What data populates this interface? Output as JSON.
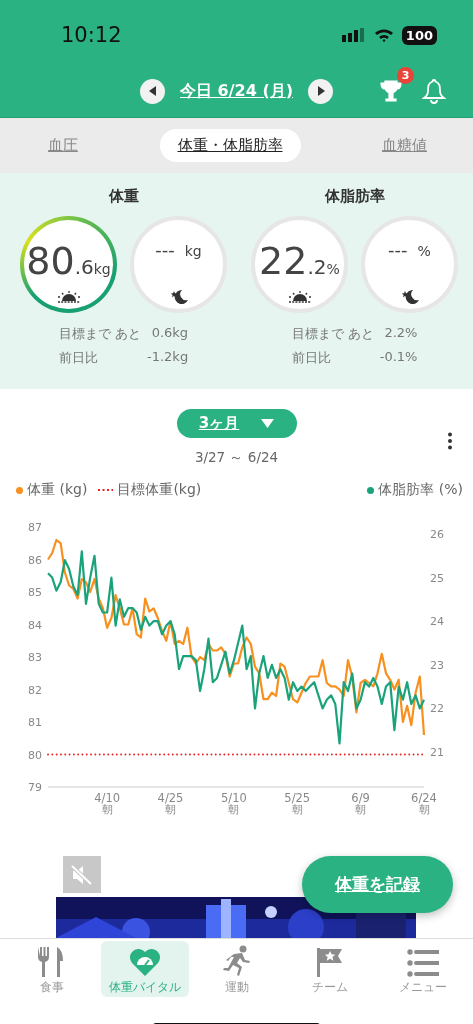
{
  "status_bar": {
    "time": "10:12",
    "battery": "100"
  },
  "header": {
    "date": "今日 6/24 (月)",
    "trophy_badge": "3"
  },
  "tabs": [
    {
      "label": "血圧",
      "selected": false
    },
    {
      "label": "体重・体脂肪率",
      "selected": true
    },
    {
      "label": "血糖値",
      "selected": false
    }
  ],
  "summary": [
    {
      "title": "体重",
      "circles": [
        {
          "kind": "morning",
          "value": "80",
          "decimal": ".6",
          "unit": "kg",
          "highlighted": true
        },
        {
          "kind": "evening",
          "value": "---",
          "unit": "kg",
          "highlighted": false
        }
      ],
      "stats": [
        {
          "label": "目標まで あと",
          "value": "0.6kg"
        },
        {
          "label": "前日比",
          "value": "-1.2kg"
        }
      ]
    },
    {
      "title": "体脂肪率",
      "circles": [
        {
          "kind": "morning",
          "value": "22",
          "decimal": ".2",
          "unit": "%",
          "highlighted": false
        },
        {
          "kind": "evening",
          "value": "---",
          "unit": "%",
          "highlighted": false
        }
      ],
      "stats": [
        {
          "label": "目標まで あと",
          "value": "2.2%"
        },
        {
          "label": "前日比",
          "value": "-0.1%"
        }
      ]
    }
  ],
  "period": {
    "label": "3ヶ月",
    "range": "3/27 ～ 6/24"
  },
  "chart": {
    "chart_data": {
      "type": "line",
      "categories": [
        null,
        null,
        null,
        null,
        null,
        null,
        null,
        null,
        null,
        null,
        null,
        null,
        null,
        null,
        "4/10$_{朝}$",
        null,
        null,
        null,
        null,
        null,
        null,
        null,
        null,
        null,
        null,
        null,
        null,
        null,
        null,
        "4/25$_{朝}$",
        null,
        null,
        null,
        null,
        null,
        null,
        null,
        null,
        null,
        null,
        null,
        null,
        null,
        null,
        "5/10$_{朝}$",
        null,
        null,
        null,
        null,
        null,
        null,
        null,
        null,
        null,
        null,
        null,
        null,
        null,
        null,
        "5/25$_{朝}$",
        null,
        null,
        null,
        null,
        null,
        null,
        null,
        null,
        null,
        null,
        null,
        null,
        null,
        null,
        "6/9$_{朝}$",
        null,
        null,
        null,
        null,
        null,
        null,
        null,
        null,
        null,
        null,
        null,
        null,
        null,
        null,
        "6/24$_{朝}$"
      ],
      "series": [
        {
          "name": "体重 (kg)",
          "color": "#f7901e",
          "values": [
            86.0,
            86.2,
            86.6,
            86.5,
            85.6,
            85.2,
            85.1,
            84.8,
            85.4,
            85.3,
            85.0,
            85.4,
            84.8,
            84.5,
            83.9,
            84.2,
            84.9,
            84.5,
            84.0,
            84.0,
            84.5,
            83.7,
            83.6,
            84.8,
            84.4,
            84.5,
            84.2,
            83.8,
            83.5,
            84.1,
            83.4,
            83.5,
            83.4,
            83.9,
            83.0,
            82.8,
            83.0,
            82.9,
            83.4,
            83.2,
            83.2,
            83.3,
            83.1,
            82.4,
            82.8,
            82.8,
            83.3,
            83.6,
            83.4,
            82.7,
            82.5,
            81.7,
            81.7,
            81.9,
            81.8,
            82.8,
            82.7,
            82.2,
            81.7,
            81.6,
            81.9,
            82.2,
            82.4,
            82.4,
            82.4,
            82.9,
            82.2,
            82.1,
            82.1,
            82.0,
            81.8,
            82.9,
            82.4,
            81.3,
            82.2,
            82.3,
            82.2,
            82.1,
            82.5,
            83.1,
            82.5,
            82.3,
            82.0,
            82.3,
            81.0,
            81.5,
            80.9,
            81.9,
            82.4,
            80.6
          ]
        },
        {
          "name": "目標体重(kg)",
          "color": "#e52421",
          "line_style": "dotted",
          "values": [
            80,
            80,
            80,
            80,
            80,
            80,
            80,
            80,
            80,
            80,
            80,
            80,
            80,
            80,
            80,
            80,
            80,
            80,
            80,
            80,
            80,
            80,
            80,
            80,
            80,
            80,
            80,
            80,
            80,
            80,
            80,
            80,
            80,
            80,
            80,
            80,
            80,
            80,
            80,
            80,
            80,
            80,
            80,
            80,
            80,
            80,
            80,
            80,
            80,
            80,
            80,
            80,
            80,
            80,
            80,
            80,
            80,
            80,
            80,
            80,
            80,
            80,
            80,
            80,
            80,
            80,
            80,
            80,
            80,
            80,
            80,
            80,
            80,
            80,
            80,
            80,
            80,
            80,
            80,
            80,
            80,
            80,
            80,
            80,
            80,
            80,
            80,
            80,
            80,
            80
          ]
        },
        {
          "name": "体脂肪率 (%)",
          "color": "#1aa37a",
          "axis": "y2",
          "values": [
            25.1,
            25.0,
            24.7,
            24.9,
            25.4,
            25.2,
            24.8,
            24.6,
            25.6,
            24.4,
            25.0,
            25.5,
            24.4,
            24.2,
            24.2,
            25.0,
            23.9,
            24.5,
            24.1,
            24.3,
            24.3,
            24.2,
            23.8,
            24.1,
            23.9,
            24.0,
            24.0,
            23.7,
            23.9,
            24.0,
            23.7,
            22.9,
            23.2,
            23.2,
            23.2,
            23.1,
            22.4,
            22.9,
            23.6,
            22.6,
            22.7,
            23.0,
            23.3,
            22.8,
            23.1,
            23.5,
            23.9,
            22.9,
            23.2,
            22.0,
            22.8,
            23.2,
            22.7,
            23.0,
            22.7,
            22.9,
            22.7,
            22.2,
            22.6,
            22.4,
            22.5,
            22.4,
            22.5,
            22.6,
            22.3,
            22.0,
            22.2,
            22.3,
            22.1,
            21.2,
            22.6,
            22.4,
            22.8,
            22.0,
            22.2,
            22.6,
            22.5,
            22.7,
            22.5,
            22.1,
            22.5,
            22.6,
            21.5,
            22.5,
            22.2,
            22.6,
            22.1,
            22.3,
            22.0,
            22.2
          ]
        }
      ],
      "ylim": [
        79,
        87
      ],
      "y2lim": [
        21,
        26
      ],
      "yticks": [
        79,
        80,
        81,
        82,
        83,
        84,
        85,
        86,
        87
      ],
      "y2ticks": [
        21,
        22,
        23,
        24,
        25,
        26
      ]
    }
  },
  "record_button": {
    "label": "体重を記録"
  },
  "nav": [
    {
      "label": "食事",
      "selected": false
    },
    {
      "label": "体重バイタル",
      "selected": true
    },
    {
      "label": "運動",
      "selected": false
    },
    {
      "label": "チーム",
      "selected": false
    },
    {
      "label": "メニュー",
      "selected": false
    }
  ]
}
